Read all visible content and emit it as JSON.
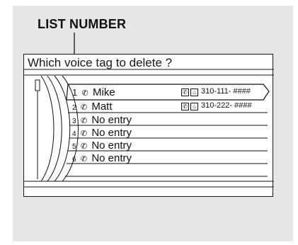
{
  "callout": {
    "label": "LIST NUMBER"
  },
  "screen": {
    "title": "Which voice tag to delete ?",
    "rows": [
      {
        "num": "1",
        "name": "Mike",
        "phone": "310-111- ####",
        "selected": true
      },
      {
        "num": "2",
        "name": "Matt",
        "phone": "310-222- ####",
        "selected": false
      },
      {
        "num": "3",
        "name": "No entry",
        "phone": "",
        "selected": false
      },
      {
        "num": "4",
        "name": "No entry",
        "phone": "",
        "selected": false
      },
      {
        "num": "5",
        "name": "No entry",
        "phone": "",
        "selected": false
      },
      {
        "num": "6",
        "name": "No entry",
        "phone": "",
        "selected": false
      }
    ],
    "icons": {
      "phone": "phone-icon",
      "entry": "phonebook-icon",
      "home": "home-icon"
    }
  }
}
